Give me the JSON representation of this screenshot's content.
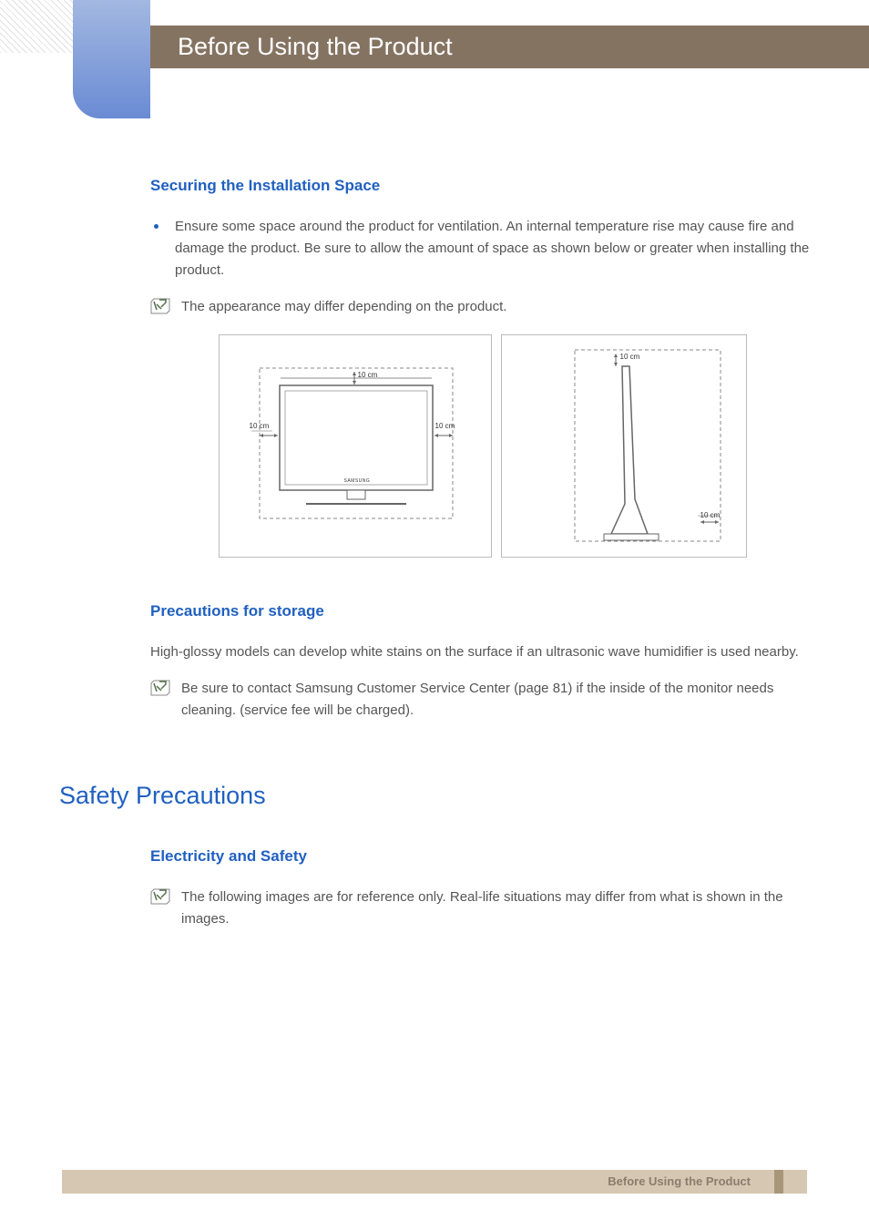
{
  "header": {
    "title": "Before Using the Product"
  },
  "sections": {
    "installation": {
      "heading": "Securing the Installation Space",
      "bullet": "Ensure some space around the product for ventilation. An internal temperature rise may cause fire and damage the product. Be sure to allow the amount of space as shown below or greater when installing the product.",
      "note": "The appearance may differ depending on the product.",
      "diagram_labels": {
        "top1": "10 cm",
        "left1": "10 cm",
        "right1": "10 cm",
        "top2": "10 cm",
        "bottom2": "10 cm",
        "brand": "SAMSUNG"
      }
    },
    "storage": {
      "heading": "Precautions for storage",
      "body": "High-glossy models can develop white stains on the surface if an ultrasonic wave humidifier is used nearby.",
      "note": "Be sure to contact Samsung Customer Service Center (page 81) if the inside of the monitor needs cleaning. (service fee will be charged)."
    },
    "safety": {
      "heading_main": "Safety Precautions",
      "subheading": "Electricity and Safety",
      "note": "The following images are for reference only. Real-life situations may differ from what is shown in the images."
    }
  },
  "footer": {
    "text": "Before Using the Product"
  }
}
